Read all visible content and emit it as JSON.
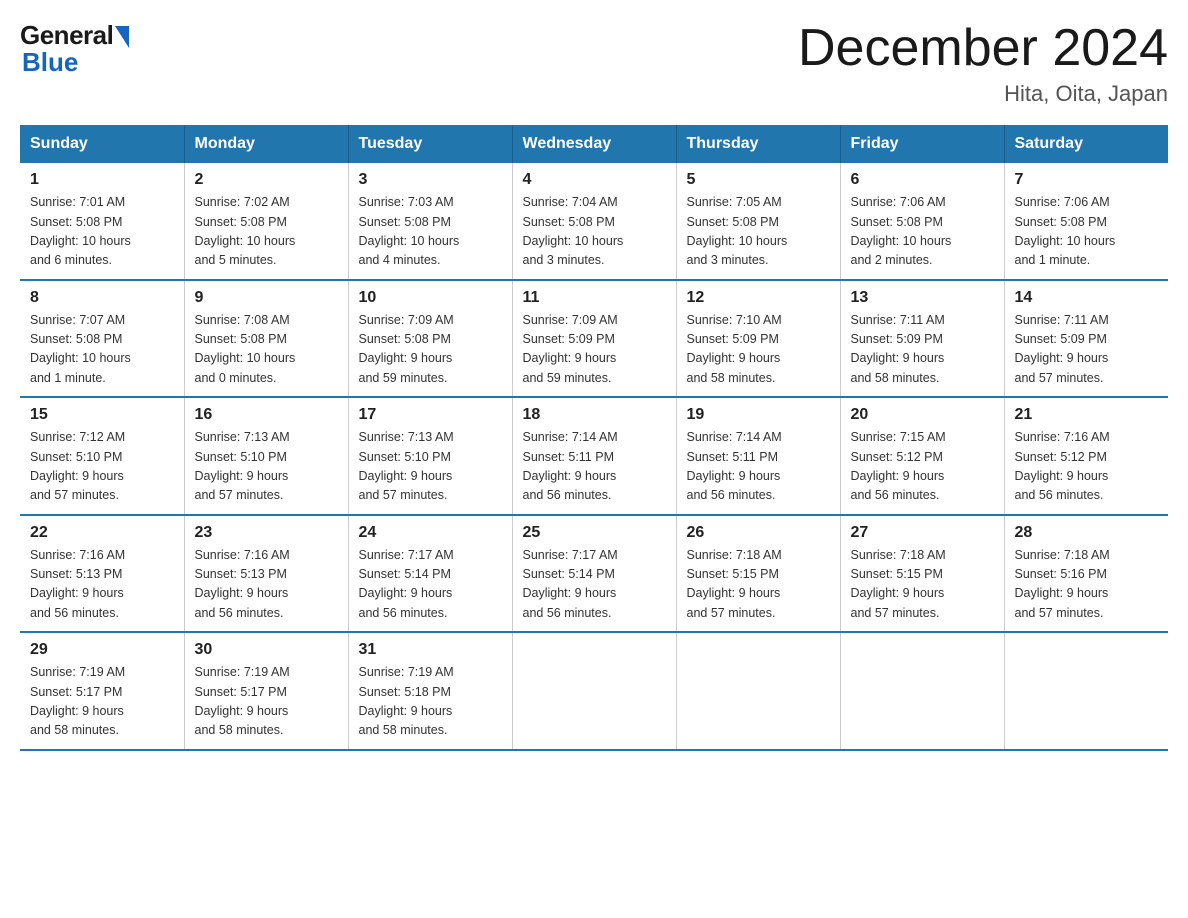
{
  "logo": {
    "general": "General",
    "blue": "Blue"
  },
  "title": "December 2024",
  "subtitle": "Hita, Oita, Japan",
  "days_of_week": [
    "Sunday",
    "Monday",
    "Tuesday",
    "Wednesday",
    "Thursday",
    "Friday",
    "Saturday"
  ],
  "weeks": [
    [
      {
        "day": "1",
        "info": "Sunrise: 7:01 AM\nSunset: 5:08 PM\nDaylight: 10 hours\nand 6 minutes."
      },
      {
        "day": "2",
        "info": "Sunrise: 7:02 AM\nSunset: 5:08 PM\nDaylight: 10 hours\nand 5 minutes."
      },
      {
        "day": "3",
        "info": "Sunrise: 7:03 AM\nSunset: 5:08 PM\nDaylight: 10 hours\nand 4 minutes."
      },
      {
        "day": "4",
        "info": "Sunrise: 7:04 AM\nSunset: 5:08 PM\nDaylight: 10 hours\nand 3 minutes."
      },
      {
        "day": "5",
        "info": "Sunrise: 7:05 AM\nSunset: 5:08 PM\nDaylight: 10 hours\nand 3 minutes."
      },
      {
        "day": "6",
        "info": "Sunrise: 7:06 AM\nSunset: 5:08 PM\nDaylight: 10 hours\nand 2 minutes."
      },
      {
        "day": "7",
        "info": "Sunrise: 7:06 AM\nSunset: 5:08 PM\nDaylight: 10 hours\nand 1 minute."
      }
    ],
    [
      {
        "day": "8",
        "info": "Sunrise: 7:07 AM\nSunset: 5:08 PM\nDaylight: 10 hours\nand 1 minute."
      },
      {
        "day": "9",
        "info": "Sunrise: 7:08 AM\nSunset: 5:08 PM\nDaylight: 10 hours\nand 0 minutes."
      },
      {
        "day": "10",
        "info": "Sunrise: 7:09 AM\nSunset: 5:08 PM\nDaylight: 9 hours\nand 59 minutes."
      },
      {
        "day": "11",
        "info": "Sunrise: 7:09 AM\nSunset: 5:09 PM\nDaylight: 9 hours\nand 59 minutes."
      },
      {
        "day": "12",
        "info": "Sunrise: 7:10 AM\nSunset: 5:09 PM\nDaylight: 9 hours\nand 58 minutes."
      },
      {
        "day": "13",
        "info": "Sunrise: 7:11 AM\nSunset: 5:09 PM\nDaylight: 9 hours\nand 58 minutes."
      },
      {
        "day": "14",
        "info": "Sunrise: 7:11 AM\nSunset: 5:09 PM\nDaylight: 9 hours\nand 57 minutes."
      }
    ],
    [
      {
        "day": "15",
        "info": "Sunrise: 7:12 AM\nSunset: 5:10 PM\nDaylight: 9 hours\nand 57 minutes."
      },
      {
        "day": "16",
        "info": "Sunrise: 7:13 AM\nSunset: 5:10 PM\nDaylight: 9 hours\nand 57 minutes."
      },
      {
        "day": "17",
        "info": "Sunrise: 7:13 AM\nSunset: 5:10 PM\nDaylight: 9 hours\nand 57 minutes."
      },
      {
        "day": "18",
        "info": "Sunrise: 7:14 AM\nSunset: 5:11 PM\nDaylight: 9 hours\nand 56 minutes."
      },
      {
        "day": "19",
        "info": "Sunrise: 7:14 AM\nSunset: 5:11 PM\nDaylight: 9 hours\nand 56 minutes."
      },
      {
        "day": "20",
        "info": "Sunrise: 7:15 AM\nSunset: 5:12 PM\nDaylight: 9 hours\nand 56 minutes."
      },
      {
        "day": "21",
        "info": "Sunrise: 7:16 AM\nSunset: 5:12 PM\nDaylight: 9 hours\nand 56 minutes."
      }
    ],
    [
      {
        "day": "22",
        "info": "Sunrise: 7:16 AM\nSunset: 5:13 PM\nDaylight: 9 hours\nand 56 minutes."
      },
      {
        "day": "23",
        "info": "Sunrise: 7:16 AM\nSunset: 5:13 PM\nDaylight: 9 hours\nand 56 minutes."
      },
      {
        "day": "24",
        "info": "Sunrise: 7:17 AM\nSunset: 5:14 PM\nDaylight: 9 hours\nand 56 minutes."
      },
      {
        "day": "25",
        "info": "Sunrise: 7:17 AM\nSunset: 5:14 PM\nDaylight: 9 hours\nand 56 minutes."
      },
      {
        "day": "26",
        "info": "Sunrise: 7:18 AM\nSunset: 5:15 PM\nDaylight: 9 hours\nand 57 minutes."
      },
      {
        "day": "27",
        "info": "Sunrise: 7:18 AM\nSunset: 5:15 PM\nDaylight: 9 hours\nand 57 minutes."
      },
      {
        "day": "28",
        "info": "Sunrise: 7:18 AM\nSunset: 5:16 PM\nDaylight: 9 hours\nand 57 minutes."
      }
    ],
    [
      {
        "day": "29",
        "info": "Sunrise: 7:19 AM\nSunset: 5:17 PM\nDaylight: 9 hours\nand 58 minutes."
      },
      {
        "day": "30",
        "info": "Sunrise: 7:19 AM\nSunset: 5:17 PM\nDaylight: 9 hours\nand 58 minutes."
      },
      {
        "day": "31",
        "info": "Sunrise: 7:19 AM\nSunset: 5:18 PM\nDaylight: 9 hours\nand 58 minutes."
      },
      {
        "day": "",
        "info": ""
      },
      {
        "day": "",
        "info": ""
      },
      {
        "day": "",
        "info": ""
      },
      {
        "day": "",
        "info": ""
      }
    ]
  ]
}
